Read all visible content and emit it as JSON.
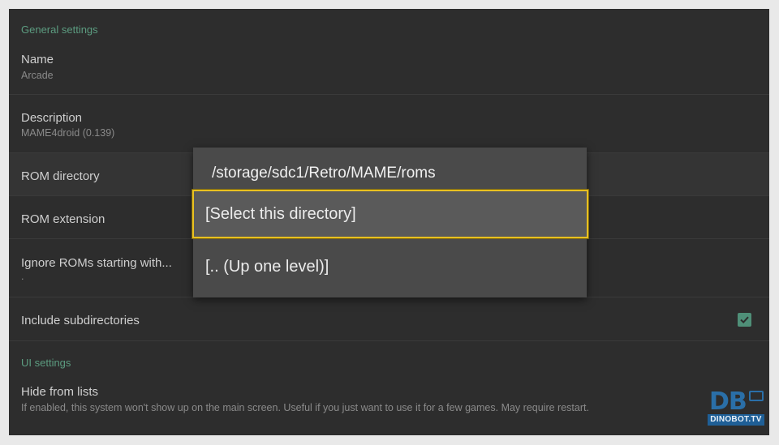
{
  "general_header": "General settings",
  "prefs": {
    "name": {
      "title": "Name",
      "summary": "Arcade"
    },
    "description": {
      "title": "Description",
      "summary": "MAME4droid (0.139)"
    },
    "rom_directory": {
      "title": "ROM directory"
    },
    "rom_extension": {
      "title": "ROM extension"
    },
    "ignore_roms": {
      "title": "Ignore ROMs starting with...",
      "summary": "."
    },
    "include_subdirs": {
      "title": "Include subdirectories",
      "checked": true
    }
  },
  "ui_header": "UI settings",
  "hide_from_lists": {
    "title": "Hide from lists",
    "summary": "If enabled, this system won't show up on the main screen. Useful if you just want to use it for a few games. May require restart."
  },
  "dialog": {
    "title": "/storage/sdc1/Retro/MAME/roms",
    "items": [
      "[Select this directory]",
      "[.. (Up one level)]"
    ]
  },
  "watermark": {
    "mark": "DB",
    "text": "DINOBOT.TV"
  },
  "colors": {
    "accent_green": "#5c9c80",
    "focus_yellow": "#e8c020",
    "background": "#2d2d2d",
    "dialog_bg": "#4a4a4a"
  }
}
